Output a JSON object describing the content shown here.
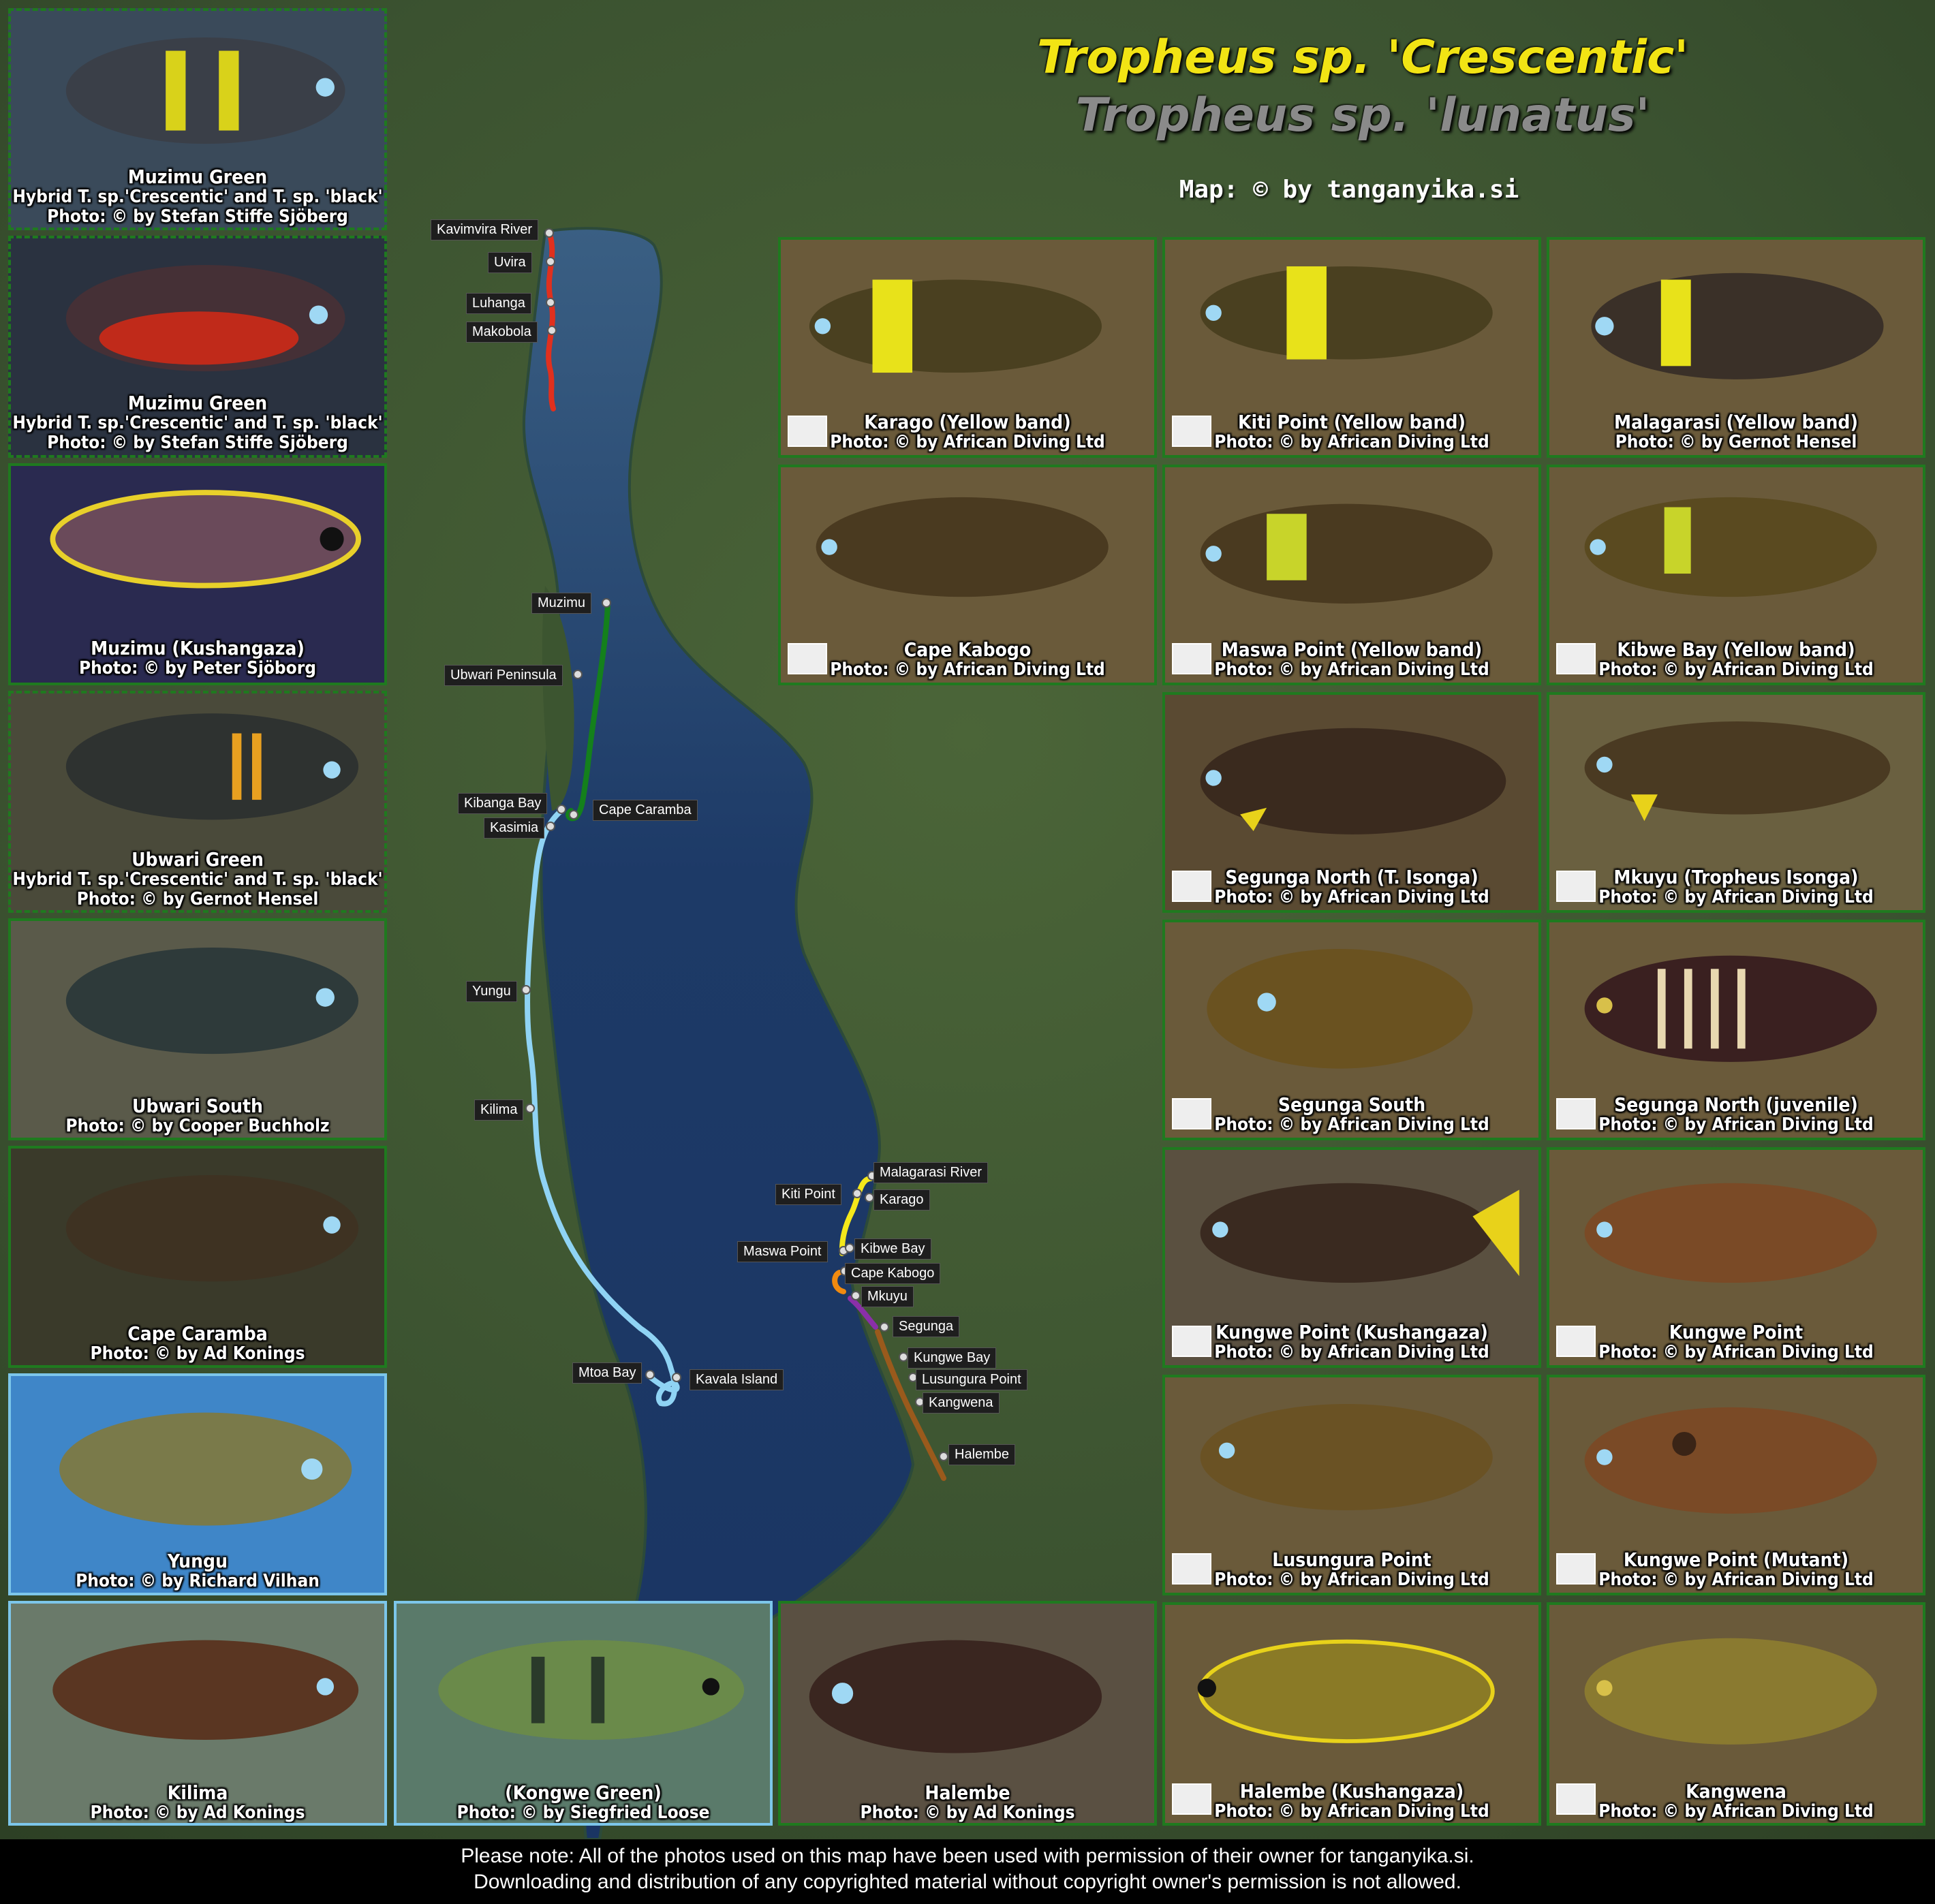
{
  "title": {
    "main": "Tropheus sp. 'Crescentic'",
    "sub": "Tropheus sp. 'lunatus'",
    "credit": "Map: © by tanganyika.si"
  },
  "colors": {
    "red_route": "#e0301e",
    "green_route": "#14801c",
    "lightblue_route": "#8fd3f4",
    "yellow_route": "#f4e81a",
    "orange_route": "#f08a10",
    "purple_route": "#8a2fa8",
    "brown_route": "#9a5a1c",
    "lake": "#1f3f6e",
    "land": "#3f5a2e"
  },
  "location_labels": [
    {
      "name": "kavimvira-river",
      "text": "Kavimvira River"
    },
    {
      "name": "uvira",
      "text": "Uvira"
    },
    {
      "name": "luhanga",
      "text": "Luhanga"
    },
    {
      "name": "makobola",
      "text": "Makobola"
    },
    {
      "name": "muzimu",
      "text": "Muzimu"
    },
    {
      "name": "ubwari-peninsula",
      "text": "Ubwari Peninsula"
    },
    {
      "name": "kibanga-bay",
      "text": "Kibanga Bay"
    },
    {
      "name": "kasimia",
      "text": "Kasimia"
    },
    {
      "name": "cape-caramba",
      "text": "Cape Caramba"
    },
    {
      "name": "yungu",
      "text": "Yungu"
    },
    {
      "name": "kilima",
      "text": "Kilima"
    },
    {
      "name": "mtoa-bay",
      "text": "Mtoa Bay"
    },
    {
      "name": "kavala-island",
      "text": "Kavala Island"
    },
    {
      "name": "malagarasi-river",
      "text": "Malagarasi River"
    },
    {
      "name": "kiti-point",
      "text": "Kiti Point"
    },
    {
      "name": "karago",
      "text": "Karago"
    },
    {
      "name": "maswa-point",
      "text": "Maswa Point"
    },
    {
      "name": "kibwe-bay",
      "text": "Kibwe Bay"
    },
    {
      "name": "cape-kabogo",
      "text": "Cape Kabogo"
    },
    {
      "name": "mkuyu",
      "text": "Mkuyu"
    },
    {
      "name": "segunga",
      "text": "Segunga"
    },
    {
      "name": "kungwe-bay",
      "text": "Kungwe Bay"
    },
    {
      "name": "lusungura-point",
      "text": "Lusungura Point"
    },
    {
      "name": "kangwena",
      "text": "Kangwena"
    },
    {
      "name": "halembe",
      "text": "Halembe"
    }
  ],
  "photos": [
    {
      "l1": "Muzimu Green",
      "l2": "Hybrid T. sp.'Crescentic' and T. sp. 'black'",
      "l3": "Photo: © by Stefan Stiffe Sjöberg"
    },
    {
      "l1": "Muzimu Green",
      "l2": "Hybrid T. sp.'Crescentic' and T. sp. 'black'",
      "l3": "Photo: © by Stefan Stiffe Sjöberg"
    },
    {
      "l1": "Muzimu (Kushangaza)",
      "l2": "Photo: © by Peter Sjöborg",
      "l3": ""
    },
    {
      "l1": "Ubwari Green",
      "l2": "Hybrid T. sp.'Crescentic' and T. sp. 'black'",
      "l3": "Photo: © by Gernot Hensel"
    },
    {
      "l1": "Ubwari South",
      "l2": "Photo: © by Cooper Buchholz",
      "l3": ""
    },
    {
      "l1": "Cape Caramba",
      "l2": "Photo: © by Ad Konings",
      "l3": ""
    },
    {
      "l1": "Yungu",
      "l2": "Photo: © by Richard Vilhan",
      "l3": ""
    },
    {
      "l1": "Kilima",
      "l2": "Photo: © by Ad Konings",
      "l3": ""
    },
    {
      "l1": "(Kongwe Green)",
      "l2": "Photo: © by Siegfried Loose",
      "l3": ""
    },
    {
      "l1": "Halembe",
      "l2": "Photo: © by Ad Konings",
      "l3": ""
    },
    {
      "l1": "Karago (Yellow band)",
      "l2": "Photo: © by African Diving Ltd",
      "l3": ""
    },
    {
      "l1": "Kiti Point (Yellow band)",
      "l2": "Photo: © by African Diving Ltd",
      "l3": ""
    },
    {
      "l1": "Malagarasi (Yellow band)",
      "l2": "Photo: © by Gernot Hensel",
      "l3": ""
    },
    {
      "l1": "Cape Kabogo",
      "l2": "Photo: © by African Diving Ltd",
      "l3": ""
    },
    {
      "l1": "Maswa Point (Yellow band)",
      "l2": "Photo: © by African Diving Ltd",
      "l3": ""
    },
    {
      "l1": "Kibwe Bay (Yellow band)",
      "l2": "Photo: © by African Diving Ltd",
      "l3": ""
    },
    {
      "l1": "Segunga North (T. Isonga)",
      "l2": "Photo: © by African Diving Ltd",
      "l3": ""
    },
    {
      "l1": "Mkuyu (Tropheus Isonga)",
      "l2": "Photo: © by African Diving Ltd",
      "l3": ""
    },
    {
      "l1": "Segunga South",
      "l2": "Photo: © by African Diving Ltd",
      "l3": ""
    },
    {
      "l1": "Segunga North (juvenile)",
      "l2": "Photo: © by African Diving Ltd",
      "l3": ""
    },
    {
      "l1": "Kungwe Point (Kushangaza)",
      "l2": "Photo: © by African Diving Ltd",
      "l3": ""
    },
    {
      "l1": "Kungwe Point",
      "l2": "Photo: © by African Diving Ltd",
      "l3": ""
    },
    {
      "l1": "Lusungura Point",
      "l2": "Photo: © by African Diving Ltd",
      "l3": ""
    },
    {
      "l1": "Kungwe Point (Mutant)",
      "l2": "Photo: © by African Diving Ltd",
      "l3": ""
    },
    {
      "l1": "Halembe (Kushangaza)",
      "l2": "Photo: © by African Diving Ltd",
      "l3": ""
    },
    {
      "l1": "Kangwena",
      "l2": "Photo: © by African Diving Ltd",
      "l3": ""
    }
  ],
  "footer": {
    "line1": "Please note: All of the photos used on this map have been used with permission of their owner for tanganyika.si.",
    "line2": "Downloading and distribution of any copyrighted material without copyright owner's permission is not allowed."
  }
}
